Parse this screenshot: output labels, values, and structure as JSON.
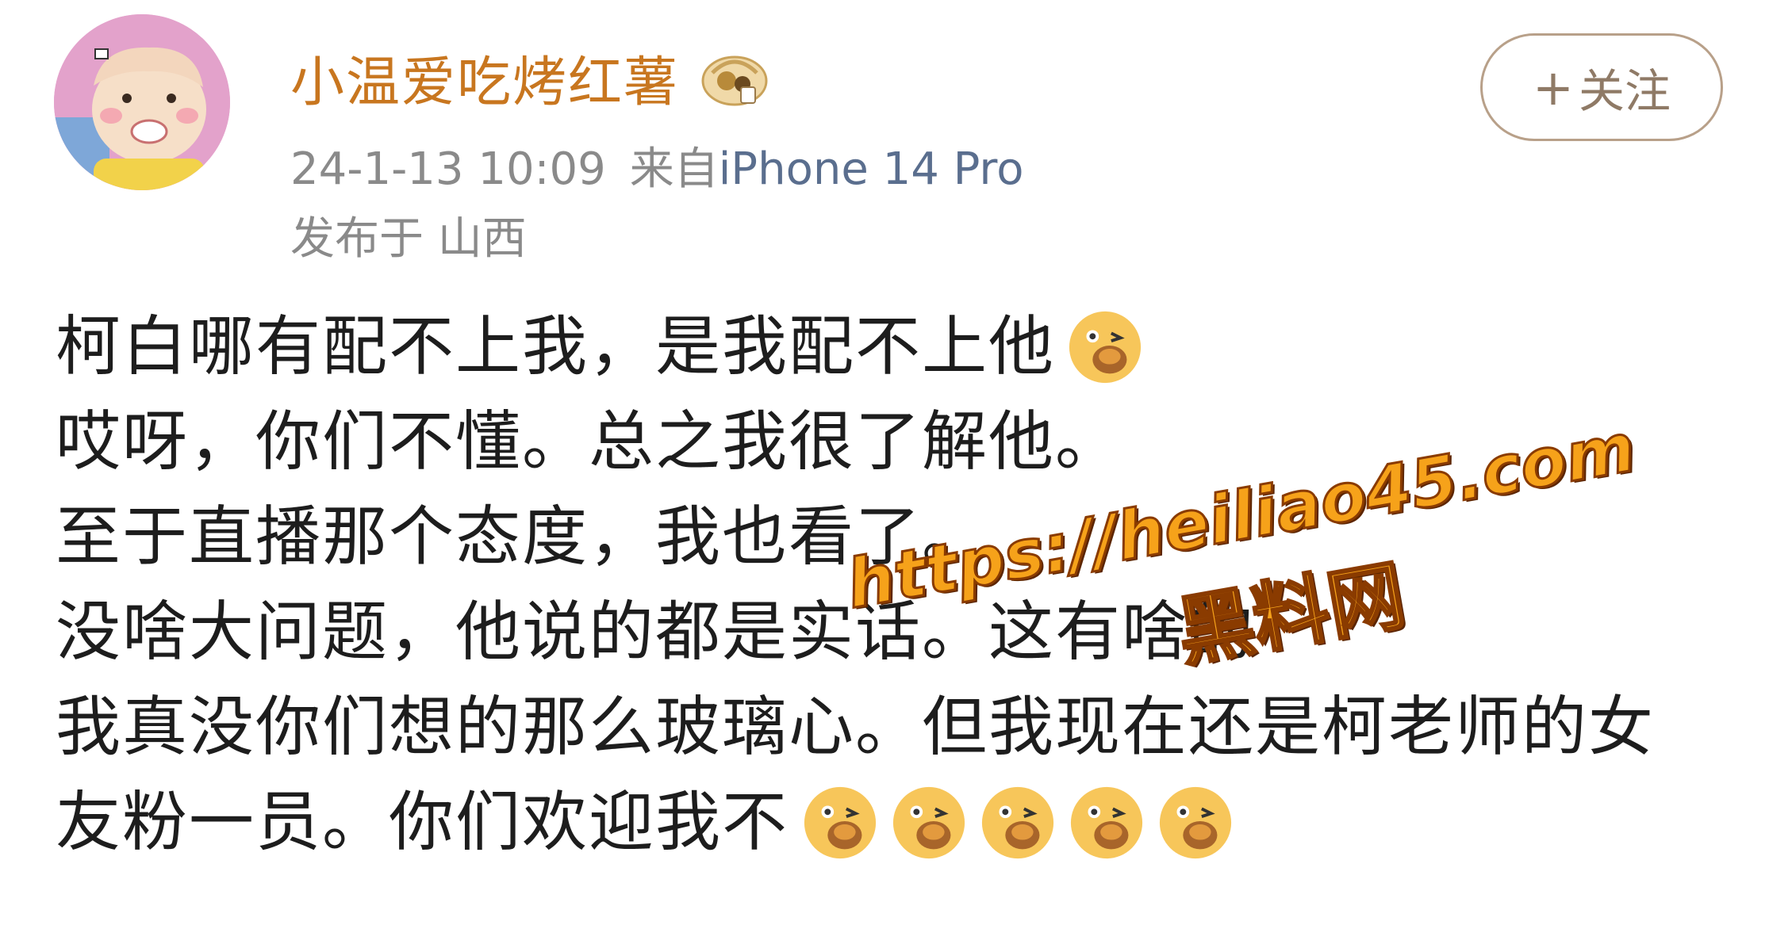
{
  "user": {
    "name": "小温爱吃烤红薯",
    "badge_icon": "vip-medal-icon"
  },
  "meta": {
    "timestamp": "24-1-13 10:09",
    "source_prefix": "来自",
    "device": "iPhone 14 Pro",
    "location": "发布于 山西"
  },
  "follow": {
    "plus": "+",
    "label": "关注"
  },
  "post": {
    "lines": [
      "柯白哪有配不上我，是我配不上他",
      "哎呀，你们不懂。总之我很了解他。",
      "至于直播那个态度，我也看了。",
      "没啥大问题，他说的都是实话。这有啥的",
      "我真没你们想的那么玻璃心。但我现在还是柯老师的女",
      "友粉一员。你们欢迎我不"
    ],
    "emoji_icon": "sweet-potato-eating-emoji-icon"
  },
  "watermark": {
    "url": "https://heiliao45.com",
    "site": "黑料网"
  },
  "colors": {
    "username": "#c8761f",
    "device_link": "#5a6e8e",
    "meta": "#8a8a8a",
    "follow_border": "#b8a089",
    "watermark_fill": "#f6a21a",
    "watermark_stroke": "#8a3b00"
  }
}
